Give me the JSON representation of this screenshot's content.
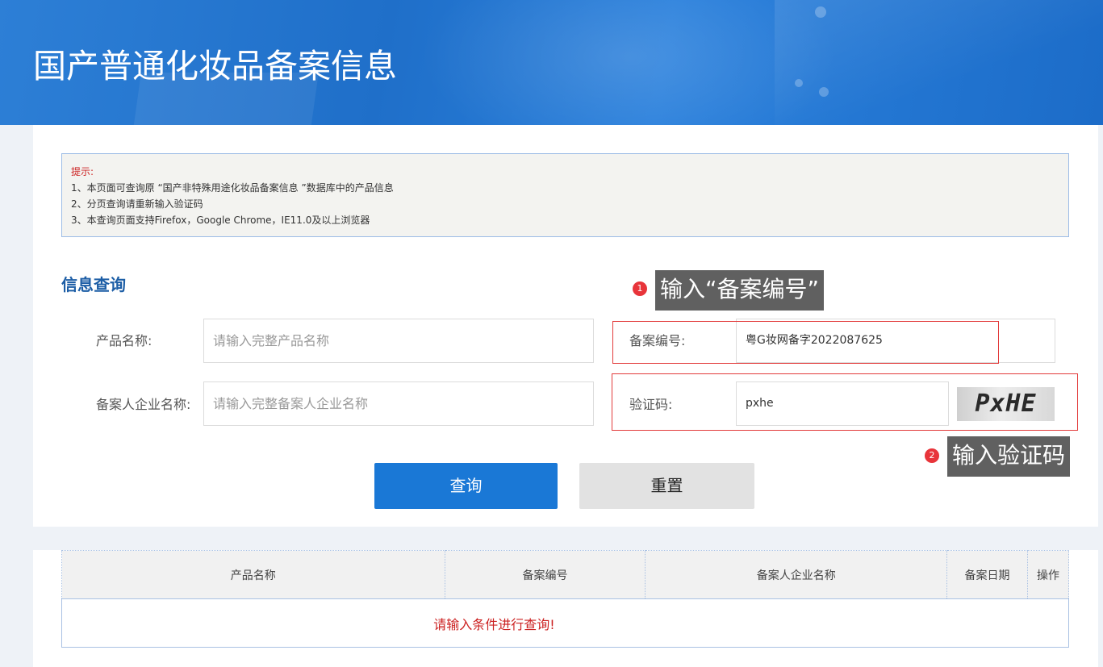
{
  "banner": {
    "title": "国产普通化妆品备案信息"
  },
  "tips": {
    "title": "提示:",
    "lines": [
      "1、本页面可查询原 “国产非特殊用途化妆品备案信息 ”数据库中的产品信息",
      "2、分页查询请重新输入验证码",
      "3、本查询页面支持Firefox，Google Chrome，IE11.0及以上浏览器"
    ]
  },
  "search": {
    "section_title": "信息查询",
    "product_name": {
      "label": "产品名称:",
      "placeholder": "请输入完整产品名称",
      "value": ""
    },
    "record_no": {
      "label": "备案编号:",
      "value": "粤G妆网备字2022087625"
    },
    "company": {
      "label": "备案人企业名称:",
      "placeholder": "请输入完整备案人企业名称",
      "value": ""
    },
    "captcha": {
      "label": "验证码:",
      "value": "pxhe",
      "image_text": "PxHE"
    },
    "query_button": "查询",
    "reset_button": "重置"
  },
  "annotations": [
    {
      "number": "1",
      "text": "输入“备案编号”"
    },
    {
      "number": "2",
      "text": "输入验证码"
    }
  ],
  "results": {
    "columns": [
      "产品名称",
      "备案编号",
      "备案人企业名称",
      "备案日期",
      "操作"
    ],
    "empty_message": "请输入条件进行查询!"
  },
  "colors": {
    "accent": "#1a78d6",
    "highlight_border": "#e23b3b",
    "tip_red": "#cc2222",
    "section_title": "#1d5ea6"
  }
}
